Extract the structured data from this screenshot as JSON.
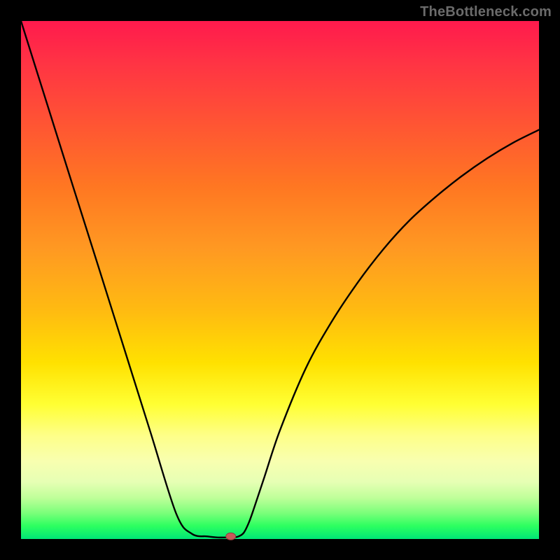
{
  "watermark": "TheBottleneck.com",
  "colors": {
    "frame_bg": "#000000",
    "curve_stroke": "#000000",
    "marker_fill": "#c75a5a",
    "marker_stroke": "#8e3c3c"
  },
  "chart_data": {
    "type": "line",
    "title": "",
    "xlabel": "",
    "ylabel": "",
    "xlim": [
      0,
      100
    ],
    "ylim": [
      0,
      100
    ],
    "grid": false,
    "legend": false,
    "x": [
      0,
      5,
      10,
      15,
      20,
      25,
      30,
      33,
      36,
      38,
      40,
      41,
      42,
      43,
      44,
      45,
      47,
      50,
      55,
      60,
      65,
      70,
      75,
      80,
      85,
      90,
      95,
      100
    ],
    "y": [
      100,
      84.1,
      68.2,
      52.4,
      36.5,
      20.6,
      4.8,
      1.0,
      0.5,
      0.3,
      0.3,
      0.3,
      0.5,
      1.2,
      3.2,
      6.0,
      12.0,
      21.0,
      33.0,
      42.0,
      49.5,
      56.0,
      61.5,
      66.0,
      70.0,
      73.5,
      76.5,
      79.0
    ],
    "marker": {
      "x": 40.5,
      "y": 0.5
    }
  }
}
